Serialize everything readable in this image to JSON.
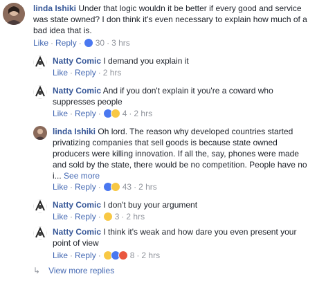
{
  "comments": [
    {
      "name": "linda Ishiki",
      "text": "Under that logic wouldn it be better if every good and service was state owned? I don think it's even necessary to explain how much of a bad idea that is.",
      "like": "Like",
      "reply": "Reply",
      "reaction_count": "30",
      "time": "3 hrs"
    },
    {
      "name": "Natty Comic",
      "text": "I demand you explain it",
      "like": "Like",
      "reply": "Reply",
      "time": "2 hrs"
    },
    {
      "name": "Natty Comic",
      "text": "And if you don't explain it you're a coward who suppresses people",
      "like": "Like",
      "reply": "Reply",
      "reaction_count": "4",
      "time": "2 hrs"
    },
    {
      "name": "linda Ishiki",
      "text": "Oh lord. The reason why developed countries started privatizing companies that sell goods is because state owned producers were killing innovation. If all the, say, phones were made and sold by the state, there would be no competition. People have no i...",
      "see_more": "See more",
      "like": "Like",
      "reply": "Reply",
      "reaction_count": "43",
      "time": "2 hrs"
    },
    {
      "name": "Natty Comic",
      "text": "I don't buy your argument",
      "like": "Like",
      "reply": "Reply",
      "reaction_count": "3",
      "time": "2 hrs"
    },
    {
      "name": "Natty Comic",
      "text": "I think it's weak and how dare you even present your point of view",
      "like": "Like",
      "reply": "Reply",
      "reaction_count": "8",
      "time": "2 hrs"
    }
  ],
  "view_more_replies": "View more replies",
  "colors": {
    "name": "#385898",
    "link": "#4267b2",
    "meta": "#90949c",
    "text": "#1d2129"
  }
}
